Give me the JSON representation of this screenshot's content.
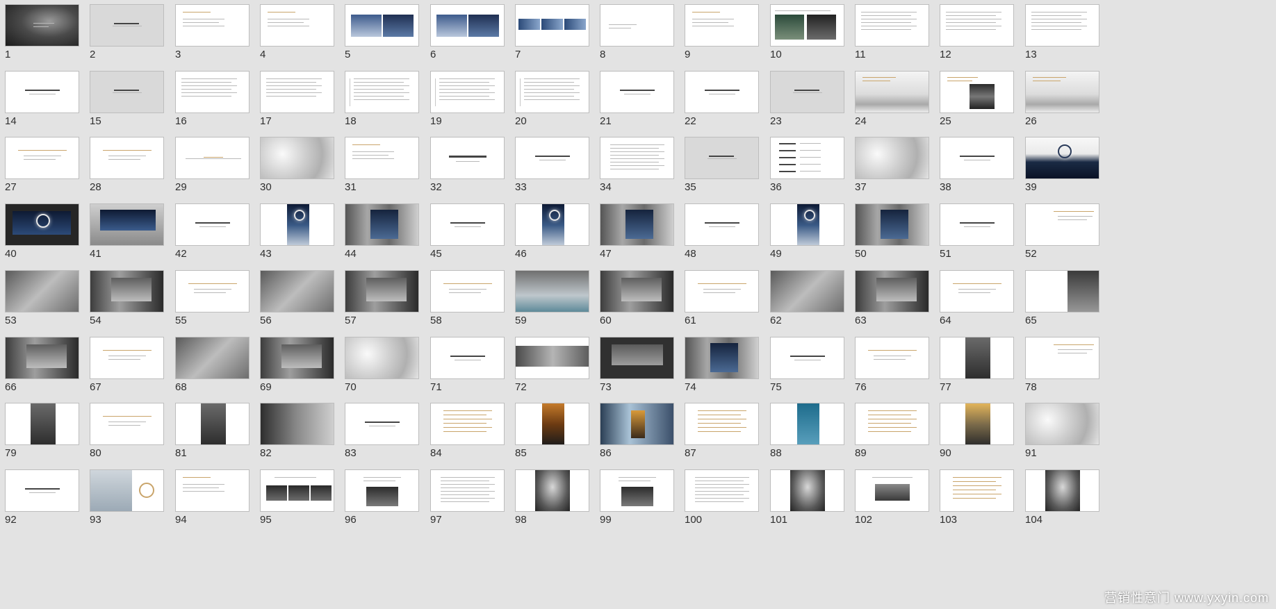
{
  "watermark": "营销性意门 www.yxyin.com",
  "colors": {
    "background": "#e3e3e3",
    "thumb_border": "#bdbdbd",
    "gold": "#c9a46a"
  },
  "slides": [
    {
      "number": "1",
      "style": "photo-dark"
    },
    {
      "number": "2",
      "style": "gray-title"
    },
    {
      "number": "3",
      "style": "text-left"
    },
    {
      "number": "4",
      "style": "text-left"
    },
    {
      "number": "5",
      "style": "photo-pair-blue"
    },
    {
      "number": "6",
      "style": "photo-pair-blue"
    },
    {
      "number": "7",
      "style": "photo-strip-blue"
    },
    {
      "number": "8",
      "style": "text-short"
    },
    {
      "number": "9",
      "style": "text-left"
    },
    {
      "number": "10",
      "style": "photo-pair-text"
    },
    {
      "number": "11",
      "style": "text-lines"
    },
    {
      "number": "12",
      "style": "text-lines"
    },
    {
      "number": "13",
      "style": "text-lines"
    },
    {
      "number": "14",
      "style": "text-center"
    },
    {
      "number": "15",
      "style": "gray-title"
    },
    {
      "number": "16",
      "style": "text-lines"
    },
    {
      "number": "17",
      "style": "text-lines"
    },
    {
      "number": "18",
      "style": "text-bar"
    },
    {
      "number": "19",
      "style": "text-bar"
    },
    {
      "number": "20",
      "style": "text-bar"
    },
    {
      "number": "21",
      "style": "text-center"
    },
    {
      "number": "22",
      "style": "text-center"
    },
    {
      "number": "23",
      "style": "gray-title"
    },
    {
      "number": "24",
      "style": "photo-mist"
    },
    {
      "number": "25",
      "style": "photo-dark-box"
    },
    {
      "number": "26",
      "style": "photo-mist"
    },
    {
      "number": "27",
      "style": "text-gold"
    },
    {
      "number": "28",
      "style": "text-gold"
    },
    {
      "number": "29",
      "style": "text-line-center"
    },
    {
      "number": "30",
      "style": "photo-shadow"
    },
    {
      "number": "31",
      "style": "text-left"
    },
    {
      "number": "32",
      "style": "text-center-big"
    },
    {
      "number": "33",
      "style": "text-center"
    },
    {
      "number": "34",
      "style": "text-lines-center"
    },
    {
      "number": "35",
      "style": "gray-title"
    },
    {
      "number": "36",
      "style": "text-list"
    },
    {
      "number": "37",
      "style": "photo-shadow"
    },
    {
      "number": "38",
      "style": "text-center"
    },
    {
      "number": "39",
      "style": "photo-eclipse"
    },
    {
      "number": "40",
      "style": "photo-eclipse-dark"
    },
    {
      "number": "41",
      "style": "photo-billboard"
    },
    {
      "number": "42",
      "style": "text-center"
    },
    {
      "number": "43",
      "style": "poster-blue"
    },
    {
      "number": "44",
      "style": "photo-city"
    },
    {
      "number": "45",
      "style": "text-center"
    },
    {
      "number": "46",
      "style": "poster-blue"
    },
    {
      "number": "47",
      "style": "photo-city"
    },
    {
      "number": "48",
      "style": "text-center"
    },
    {
      "number": "49",
      "style": "poster-blue"
    },
    {
      "number": "50",
      "style": "photo-city"
    },
    {
      "number": "51",
      "style": "text-center"
    },
    {
      "number": "52",
      "style": "text-gold-right"
    },
    {
      "number": "53",
      "style": "photo-gray"
    },
    {
      "number": "54",
      "style": "photo-billboard-gray"
    },
    {
      "number": "55",
      "style": "text-gold"
    },
    {
      "number": "56",
      "style": "photo-gray"
    },
    {
      "number": "57",
      "style": "photo-billboard-gray"
    },
    {
      "number": "58",
      "style": "text-gold"
    },
    {
      "number": "59",
      "style": "photo-fog"
    },
    {
      "number": "60",
      "style": "photo-billboard-gray"
    },
    {
      "number": "61",
      "style": "text-gold"
    },
    {
      "number": "62",
      "style": "photo-gray"
    },
    {
      "number": "63",
      "style": "photo-billboard-gray"
    },
    {
      "number": "64",
      "style": "text-gold"
    },
    {
      "number": "65",
      "style": "photo-gray-right"
    },
    {
      "number": "66",
      "style": "photo-billboard-gray"
    },
    {
      "number": "67",
      "style": "text-gold"
    },
    {
      "number": "68",
      "style": "photo-gray"
    },
    {
      "number": "69",
      "style": "photo-billboard-gray"
    },
    {
      "number": "70",
      "style": "photo-shadow"
    },
    {
      "number": "71",
      "style": "text-center"
    },
    {
      "number": "72",
      "style": "photo-banner"
    },
    {
      "number": "73",
      "style": "photo-dark-board"
    },
    {
      "number": "74",
      "style": "photo-city"
    },
    {
      "number": "75",
      "style": "text-center"
    },
    {
      "number": "76",
      "style": "text-gold"
    },
    {
      "number": "77",
      "style": "poster-gray"
    },
    {
      "number": "78",
      "style": "text-gold-right"
    },
    {
      "number": "79",
      "style": "poster-gray"
    },
    {
      "number": "80",
      "style": "text-gold"
    },
    {
      "number": "81",
      "style": "poster-gray"
    },
    {
      "number": "82",
      "style": "photo-room"
    },
    {
      "number": "83",
      "style": "text-center"
    },
    {
      "number": "84",
      "style": "text-gold-block"
    },
    {
      "number": "85",
      "style": "poster-orange"
    },
    {
      "number": "86",
      "style": "photo-street"
    },
    {
      "number": "87",
      "style": "text-gold-block"
    },
    {
      "number": "88",
      "style": "poster-teal"
    },
    {
      "number": "89",
      "style": "text-gold-block"
    },
    {
      "number": "90",
      "style": "poster-sunset"
    },
    {
      "number": "91",
      "style": "photo-shadow"
    },
    {
      "number": "92",
      "style": "text-center"
    },
    {
      "number": "93",
      "style": "photo-moon"
    },
    {
      "number": "94",
      "style": "text-left"
    },
    {
      "number": "95",
      "style": "photo-trio"
    },
    {
      "number": "96",
      "style": "photo-duo-text"
    },
    {
      "number": "97",
      "style": "text-lines-center"
    },
    {
      "number": "98",
      "style": "portrait"
    },
    {
      "number": "99",
      "style": "photo-duo-text"
    },
    {
      "number": "100",
      "style": "text-lines-center"
    },
    {
      "number": "101",
      "style": "portrait"
    },
    {
      "number": "102",
      "style": "photo-landscape-text"
    },
    {
      "number": "103",
      "style": "text-gold-block"
    },
    {
      "number": "104",
      "style": "portrait"
    }
  ]
}
